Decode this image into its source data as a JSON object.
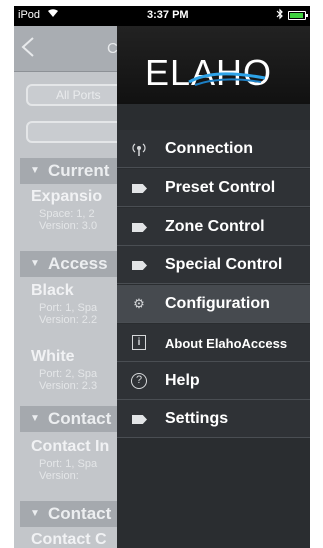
{
  "status_bar": {
    "carrier": "iPod",
    "time": "3:37 PM",
    "battery_level": 0.9,
    "battery_color": "#3fd23f"
  },
  "background_app": {
    "title": "C",
    "port_selector": "All Ports",
    "sections": [
      {
        "title": "Current"
      },
      {
        "title": "Access"
      },
      {
        "title": "Contact"
      },
      {
        "title": "Contact"
      }
    ],
    "items": [
      {
        "title": "Expansio",
        "line1": "Space: 1, 2",
        "line2": "Version: 3.0"
      },
      {
        "title": "Black",
        "line1": "Port: 1, Spa",
        "line2": "Version: 2.2"
      },
      {
        "title": "White",
        "line1": "Port: 2, Spa",
        "line2": "Version: 2.3"
      },
      {
        "title": "Contact In",
        "line1": "Port: 1, Spa",
        "line2": "Version:"
      },
      {
        "title": "Contact C"
      }
    ]
  },
  "menu": {
    "logo": "ELAHO",
    "items": [
      {
        "label": "Connection",
        "icon": "antenna-icon"
      },
      {
        "label": "Preset Control",
        "icon": "tag-icon"
      },
      {
        "label": "Zone Control",
        "icon": "tag-icon"
      },
      {
        "label": "Special Control",
        "icon": "tag-icon"
      },
      {
        "label": "Configuration",
        "icon": "gear-icon"
      },
      {
        "label": "About ElahoAccess",
        "icon": "info-icon"
      },
      {
        "label": "Help",
        "icon": "help-icon"
      },
      {
        "label": "Settings",
        "icon": "tag-icon"
      }
    ],
    "active_index": 4
  }
}
